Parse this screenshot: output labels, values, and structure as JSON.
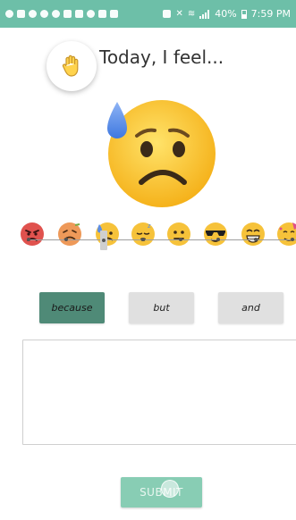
{
  "status_bar": {
    "battery": "40%",
    "time": "7:59 PM",
    "color": "#6dbfa8"
  },
  "header": {
    "icon": "raised-hand-icon",
    "title": "Today, I feel..."
  },
  "selected_mood": {
    "icon": "anxious-sweat-face-icon",
    "index": 2
  },
  "moods": [
    {
      "icon": "angry-face-icon"
    },
    {
      "icon": "dizzy-face-icon"
    },
    {
      "icon": "anxious-sweat-face-icon"
    },
    {
      "icon": "sleepy-face-icon"
    },
    {
      "icon": "neutral-face-icon"
    },
    {
      "icon": "sunglasses-face-icon"
    },
    {
      "icon": "grinning-face-icon"
    },
    {
      "icon": "party-face-icon"
    }
  ],
  "conjunctions": {
    "because": "because",
    "but": "but",
    "and": "and",
    "active": "because",
    "active_color": "#4f8a77"
  },
  "note": {
    "value": ""
  },
  "submit": {
    "label": "SUBMIT",
    "color": "#88cdb4"
  }
}
